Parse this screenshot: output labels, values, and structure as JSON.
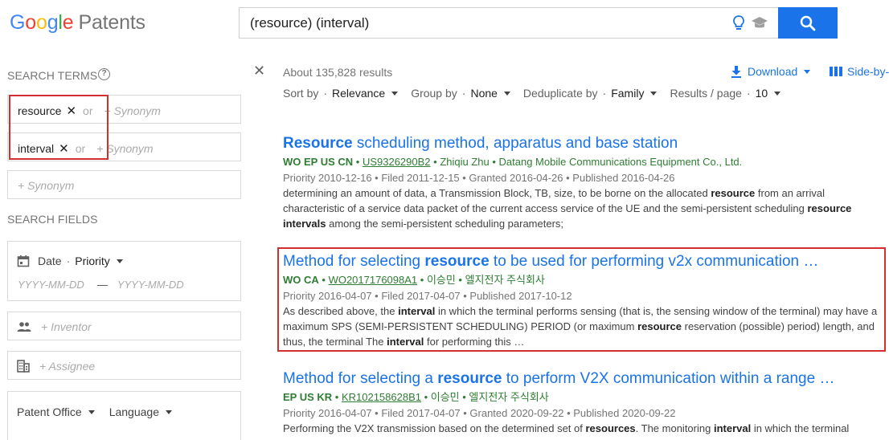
{
  "header": {
    "logo_letters": [
      "G",
      "o",
      "o",
      "g",
      "l",
      "e"
    ],
    "logo_product": "Patents",
    "query": "(resource) (interval)"
  },
  "left": {
    "search_terms_title": "SEARCH TERMS",
    "terms": [
      {
        "value": "resource",
        "or": "or",
        "synonym": "+ Synonym"
      },
      {
        "value": "interval",
        "or": "or",
        "synonym": "+ Synonym"
      }
    ],
    "empty_synonym": "+ Synonym",
    "search_fields_title": "SEARCH FIELDS",
    "date_label": "Date",
    "date_type": "Priority",
    "date_from_placeholder": "YYYY-MM-DD",
    "date_to_placeholder": "YYYY-MM-DD",
    "inventor_placeholder": "+ Inventor",
    "assignee_placeholder": "+ Assignee",
    "patent_office": "Patent Office",
    "language": "Language"
  },
  "results_header": {
    "count": "About 135,828 results",
    "download": "Download",
    "side_by_side": "Side-by-",
    "sort_label": "Sort by",
    "sort_value": "Relevance",
    "group_label": "Group by",
    "group_value": "None",
    "dedupe_label": "Deduplicate by",
    "dedupe_value": "Family",
    "per_page_label": "Results / page",
    "per_page_value": "10"
  },
  "results": [
    {
      "title_bold": "Resource",
      "title_rest": " scheduling method, apparatus and base station",
      "codes": "WO EP US CN",
      "pub": "US9326290B2",
      "people": "Zhiqiu Zhu • Datang Mobile Communications Equipment Co., Ltd.",
      "dates": "Priority 2010-12-16 • Filed 2011-12-15 • Granted 2016-04-26 • Published 2016-04-26",
      "snippet": [
        {
          "t": "determining an amount of data, a Transmission Block, TB, size, to be borne on the allocated ",
          "b": false
        },
        {
          "t": "resource",
          "b": true
        },
        {
          "t": " from an arrival characteristic of a service data packet of the current access service of the UE and the semi-persistent scheduling ",
          "b": false
        },
        {
          "t": "resource intervals",
          "b": true
        },
        {
          "t": " among the semi-persistent scheduling parameters;",
          "b": false
        }
      ]
    },
    {
      "title_pre": "Method for selecting ",
      "title_bold": "resource",
      "title_rest": " to be used for performing v2x communication …",
      "codes": "WO CA",
      "pub": "WO2017176098A1",
      "people": "이승민 • 엘지전자 주식회사",
      "dates": "Priority 2016-04-07 • Filed 2017-04-07 • Published 2017-10-12",
      "snippet": [
        {
          "t": "As described above, the ",
          "b": false
        },
        {
          "t": "interval",
          "b": true
        },
        {
          "t": " in which the terminal performs sensing (that is, the sensing window of the terminal) may have a maximum SPS (SEMI-PERSISTENT SCHEDULING) PERIOD (or maximum ",
          "b": false
        },
        {
          "t": "resource",
          "b": true
        },
        {
          "t": " reservation (possible) period) length, and thus, the terminal The ",
          "b": false
        },
        {
          "t": "interval",
          "b": true
        },
        {
          "t": " for performing this …",
          "b": false
        }
      ]
    },
    {
      "title_pre": "Method for selecting a ",
      "title_bold": "resource",
      "title_rest": " to perform V2X communication within a range …",
      "codes": "EP US KR",
      "pub": "KR102158628B1",
      "people": "이승민 • 엘지전자 주식회사",
      "dates": "Priority 2016-04-07 • Filed 2017-04-07 • Granted 2020-09-22 • Published 2020-09-22",
      "snippet": [
        {
          "t": "Performing the V2X transmission based on the determined set of ",
          "b": false
        },
        {
          "t": "resources",
          "b": true
        },
        {
          "t": ". The monitoring ",
          "b": false
        },
        {
          "t": "interval",
          "b": true
        },
        {
          "t": " in which the terminal",
          "b": false
        }
      ]
    }
  ],
  "colors": {
    "accent": "#1a73e8",
    "meta_green": "#2e7d32",
    "highlight_red": "#d32f2f"
  }
}
